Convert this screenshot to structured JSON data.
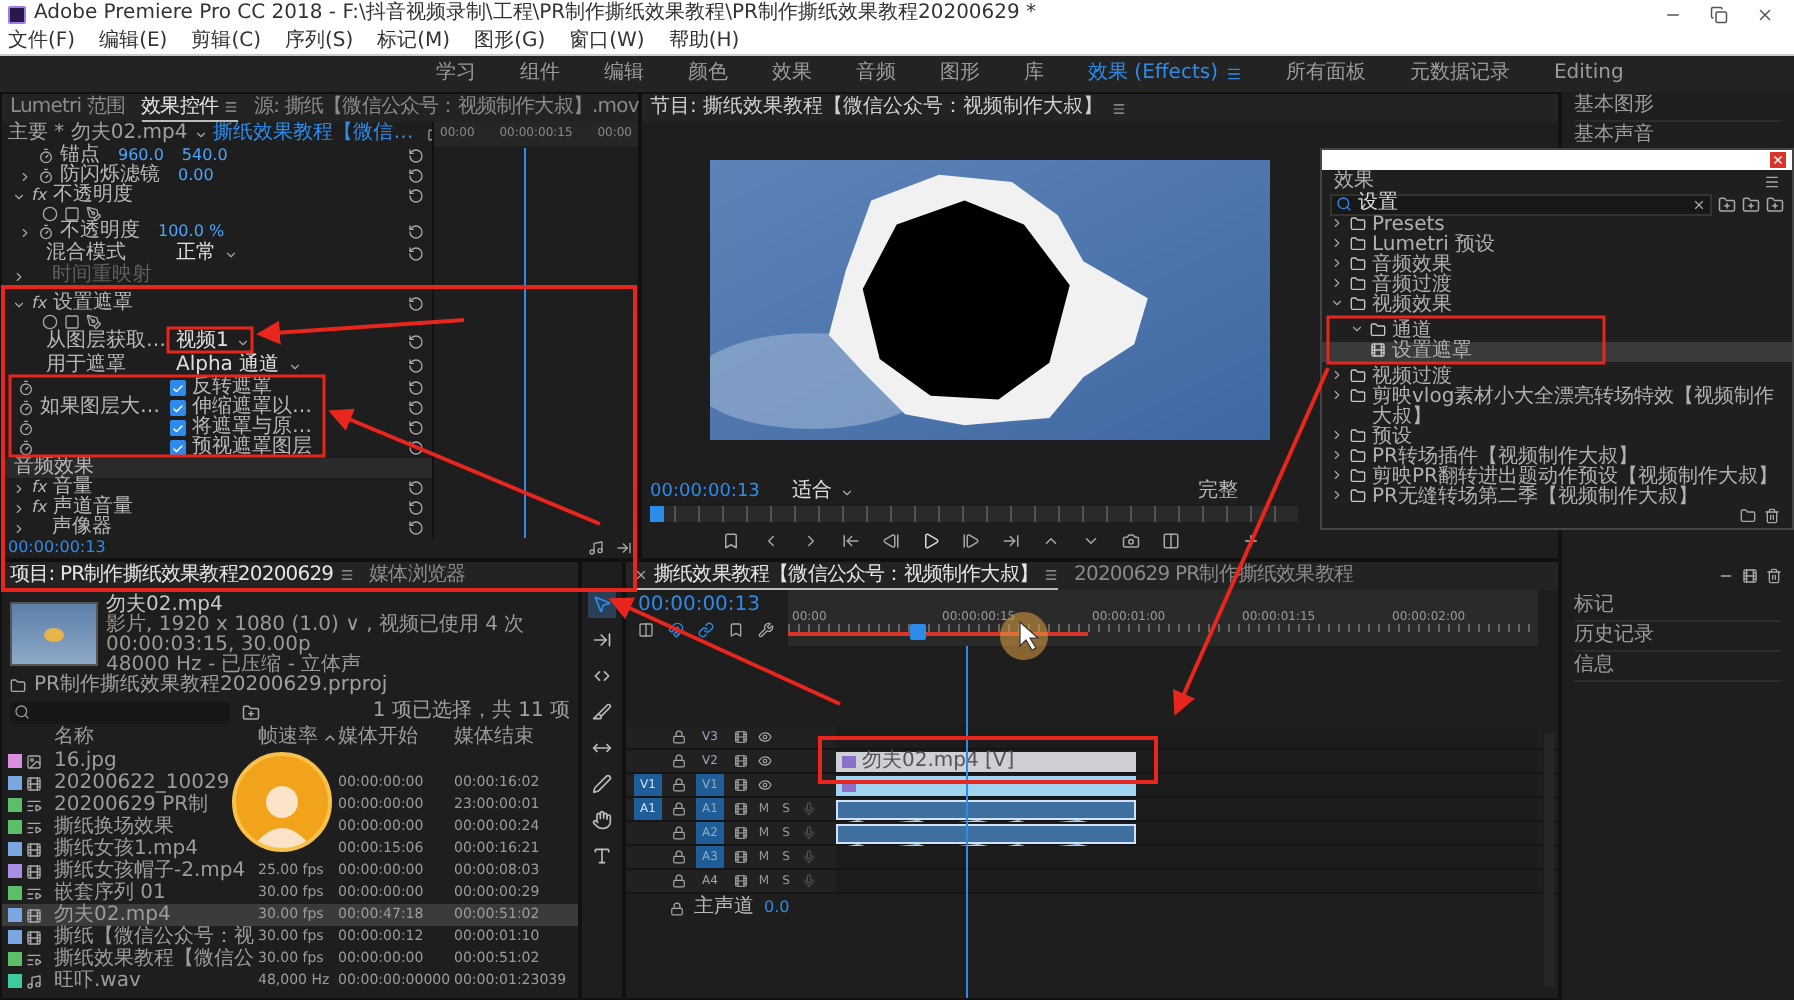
{
  "window": {
    "title": "Adobe Premiere Pro CC 2018 - F:\\抖音视频录制\\工程\\PR制作撕纸效果教程\\PR制作撕纸效果教程20200629 *"
  },
  "menu": [
    "文件(F)",
    "编辑(E)",
    "剪辑(C)",
    "序列(S)",
    "标记(M)",
    "图形(G)",
    "窗口(W)",
    "帮助(H)"
  ],
  "workspaces": [
    {
      "label": "学习",
      "selected": false
    },
    {
      "label": "组件",
      "selected": false
    },
    {
      "label": "编辑",
      "selected": false
    },
    {
      "label": "颜色",
      "selected": false
    },
    {
      "label": "效果",
      "selected": false
    },
    {
      "label": "音频",
      "selected": false
    },
    {
      "label": "图形",
      "selected": false
    },
    {
      "label": "库",
      "selected": false
    },
    {
      "label": "效果 (Effects)",
      "selected": true
    },
    {
      "label": "所有面板",
      "selected": false
    },
    {
      "label": "元数据记录",
      "selected": false
    },
    {
      "label": "Editing",
      "selected": false
    }
  ],
  "effect_controls": {
    "tabs": [
      {
        "label": "Lumetri 范围",
        "selected": false
      },
      {
        "label": "效果控件",
        "selected": true
      },
      {
        "label": "源: 撕纸【微信公众号：视频制作大叔】.mov",
        "selected": false
      }
    ],
    "clip_path": "主要 * 勿夫02.mp4",
    "sequence": "撕纸效果教程【微信…",
    "ruler": [
      "00:00",
      "00:00:00:15",
      "00:00"
    ],
    "rows": [
      {
        "kind": "param",
        "label": "锚点",
        "values": [
          "960.0",
          "540.0"
        ]
      },
      {
        "kind": "param",
        "label": "防闪烁滤镜",
        "values": [
          "0.00"
        ],
        "expanded": false
      },
      {
        "kind": "section",
        "badge": "fx",
        "label": "不透明度",
        "expanded": true
      },
      {
        "kind": "tools"
      },
      {
        "kind": "param",
        "label": "不透明度",
        "values": [
          "100.0 %"
        ],
        "expanded": false
      },
      {
        "kind": "dropdown",
        "label": "混合模式",
        "value": "正常"
      },
      {
        "kind": "section",
        "label": "时间重映射",
        "expanded": false,
        "disabled": true
      },
      {
        "kind": "section",
        "badge": "fx",
        "label": "设置遮罩",
        "expanded": true
      },
      {
        "kind": "tools"
      },
      {
        "kind": "dropdown",
        "label": "从图层获取…",
        "value": "视频1"
      },
      {
        "kind": "dropdown",
        "label": "用于遮罩",
        "value": "Alpha 通道"
      },
      {
        "kind": "check",
        "text": "反转遮罩",
        "checked": true
      },
      {
        "kind": "check",
        "label": "如果图层大…",
        "text": "伸缩遮罩以…",
        "checked": true
      },
      {
        "kind": "check",
        "text": "将遮罩与原…",
        "checked": true
      },
      {
        "kind": "check",
        "text": "预视遮罩图层",
        "checked": true
      },
      {
        "kind": "group",
        "label": "音频效果"
      },
      {
        "kind": "section",
        "badge": "fx",
        "label": "音量",
        "expanded": false
      },
      {
        "kind": "section",
        "badge": "fx",
        "label": "声道音量",
        "expanded": false
      },
      {
        "kind": "section",
        "label": "声像器",
        "expanded": false
      }
    ],
    "timecode": "00:00:00:13"
  },
  "monitor": {
    "title": "节目: 撕纸效果教程【微信公众号：视频制作大叔】",
    "timecode": "00:00:00:13",
    "zoom": "适合",
    "resolution": "完整"
  },
  "effects": {
    "title": "效果",
    "search": {
      "value": "设置"
    },
    "tree": [
      {
        "label": "Presets",
        "expanded": false,
        "selected": false
      },
      {
        "label": "Lumetri 预设",
        "expanded": false,
        "selected": false
      },
      {
        "label": "音频效果",
        "expanded": false,
        "selected": false
      },
      {
        "label": "音频过渡",
        "expanded": false,
        "selected": false
      },
      {
        "label": "视频效果",
        "expanded": true,
        "selected": false,
        "children": [
          {
            "label": "通道",
            "expanded": true,
            "selected": false,
            "children": [
              {
                "label": "设置遮罩",
                "selected": true
              }
            ]
          }
        ]
      },
      {
        "label": "视频过渡",
        "expanded": false,
        "selected": false
      },
      {
        "label": "剪映vlog素材小大全漂亮转场特效【视频制作大叔】",
        "expanded": false,
        "selected": false
      },
      {
        "label": "预设",
        "expanded": false,
        "selected": false
      },
      {
        "label": "PR转场插件【视频制作大叔】",
        "expanded": false,
        "selected": false
      },
      {
        "label": "剪映PR翻转进出题动作预设【视频制作大叔】",
        "expanded": false,
        "selected": false
      },
      {
        "label": "PR无缝转场第二季【视频制作大叔】",
        "expanded": false,
        "selected": false
      }
    ]
  },
  "right_panels": {
    "top": [
      "基本图形",
      "基本声音"
    ],
    "bottom": [
      "标记",
      "历史记录",
      "信息"
    ]
  },
  "project": {
    "tabs": [
      {
        "label": "项目: PR制作撕纸效果教程20200629",
        "selected": true
      },
      {
        "label": "媒体浏览器",
        "selected": false
      }
    ],
    "preview": [
      "勿夫02.mp4",
      "影片, 1920 x 1080 (1.0) ∨ , 视频已使用 4 次",
      "00:00:03:15, 30.00p",
      "48000 Hz - 已压缩 - 立体声"
    ],
    "file": "PR制作撕纸效果教程20200629.prproj",
    "selection": "1 项已选择，共 11 项",
    "columns": [
      {
        "label": "名称",
        "sorted": false
      },
      {
        "label": "帧速率",
        "sorted": true
      },
      {
        "label": "媒体开始",
        "sorted": false
      },
      {
        "label": "媒体结束",
        "sorted": false
      }
    ],
    "rows": [
      {
        "color": "#d98ee0",
        "kind": "image",
        "name": "16.jpg",
        "selected": false
      },
      {
        "color": "#7aa7e0",
        "kind": "video",
        "name": "20200622_10029",
        "start": "00:00:00:00",
        "end": "00:00:16:02",
        "selected": false
      },
      {
        "color": "#5bbf6a",
        "kind": "sequence",
        "name": "20200629 PR制",
        "start": "00:00:00:00",
        "end": "23:00:00:01",
        "selected": false
      },
      {
        "color": "#5bbf6a",
        "kind": "sequence",
        "name": "撕纸换场效果",
        "start": "00:00:00:00",
        "end": "00:00:00:24",
        "selected": false
      },
      {
        "color": "#7aa7e0",
        "kind": "video",
        "name": "撕纸女孩1.mp4",
        "start": "00:00:15:06",
        "end": "00:00:16:21",
        "selected": false
      },
      {
        "color": "#a98ee8",
        "kind": "video",
        "name": "撕纸女孩帽子-2.mp4",
        "fps": "25.00 fps",
        "start": "00:00:00:00",
        "end": "00:00:08:03",
        "selected": false
      },
      {
        "color": "#5bbf6a",
        "kind": "sequence",
        "name": "嵌套序列 01",
        "fps": "30.00 fps",
        "start": "00:00:00:00",
        "end": "00:00:00:29",
        "selected": false
      },
      {
        "color": "#7aa7e0",
        "kind": "video",
        "name": "勿夫02.mp4",
        "fps": "30.00 fps",
        "start": "00:00:47:18",
        "end": "00:00:51:02",
        "selected": true
      },
      {
        "color": "#7aa7e0",
        "kind": "video",
        "name": "撕纸【微信公众号：视",
        "fps": "30.00 fps",
        "start": "00:00:00:12",
        "end": "00:00:01:10",
        "selected": false
      },
      {
        "color": "#5bbf6a",
        "kind": "sequence",
        "name": "撕纸效果教程【微信公",
        "fps": "30.00 fps",
        "start": "00:00:00:00",
        "end": "00:00:51:02",
        "selected": false
      },
      {
        "color": "#3ec9a0",
        "kind": "audio",
        "name": "旺吓.wav",
        "fps": "48,000 Hz",
        "start": "00:00:00:00000",
        "end": "00:00:01:23039",
        "selected": false
      }
    ]
  },
  "tools": [
    {
      "kind": "select",
      "selected": true
    },
    {
      "kind": "track-select",
      "selected": false
    },
    {
      "kind": "ripple",
      "selected": false
    },
    {
      "kind": "razor",
      "selected": false
    },
    {
      "kind": "slip",
      "selected": false
    },
    {
      "kind": "pen",
      "selected": false
    },
    {
      "kind": "hand",
      "selected": false
    },
    {
      "kind": "type",
      "selected": false
    }
  ],
  "timeline": {
    "tabs": [
      {
        "label": "撕纸效果教程【微信公众号：视频制作大叔】",
        "selected": true,
        "closable": true
      },
      {
        "label": "20200629 PR制作撕纸效果教程",
        "selected": false,
        "closable": false
      }
    ],
    "timecode": "00:00:00:13",
    "ruler": [
      "00:00",
      "00:00:00:15",
      "00:00:01:00",
      "00:00:01:15",
      "00:00:02:00"
    ],
    "tracks": [
      {
        "name": "V3",
        "kind": "video",
        "targeted": false
      },
      {
        "name": "V2",
        "kind": "video",
        "targeted": false,
        "clip": {
          "kind": "video",
          "label": "勿夫02.mp4 [V]",
          "fx": true
        }
      },
      {
        "name": "V1",
        "kind": "video",
        "source": "V1",
        "targeted": true,
        "clip": {
          "kind": "video",
          "fx": true
        }
      },
      {
        "name": "A1",
        "kind": "audio",
        "source": "A1",
        "targeted": true,
        "buttons": [
          "M",
          "S"
        ],
        "clip": {
          "kind": "audio"
        }
      },
      {
        "name": "A2",
        "kind": "audio",
        "targeted": true,
        "buttons": [
          "M",
          "S"
        ],
        "clip": {
          "kind": "audio"
        }
      },
      {
        "name": "A3",
        "kind": "audio",
        "targeted": true,
        "buttons": [
          "M",
          "S"
        ]
      },
      {
        "name": "A4",
        "kind": "audio",
        "targeted": false,
        "buttons": [
          "M",
          "S"
        ]
      }
    ],
    "master": {
      "label": "主声道",
      "value": "0.0"
    }
  }
}
